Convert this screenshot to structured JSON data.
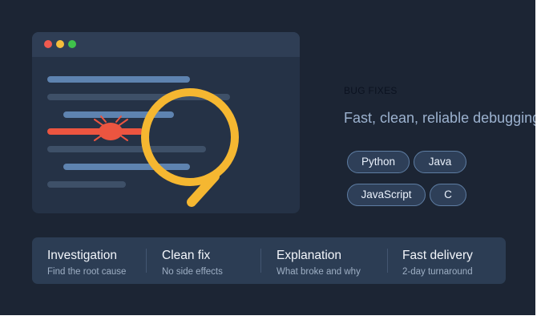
{
  "colors": {
    "background": "#1c2534",
    "editor": "#253246",
    "titlebar": "#2f3e55",
    "bug": "#ec5540",
    "magnifier": "#f5b731",
    "code_line": "#5e83b0",
    "pill_border": "#5e7da3",
    "panel": "#2c3d54"
  },
  "editor": {
    "traffic_lights": [
      "red",
      "yellow",
      "green"
    ],
    "illustration_icons": [
      "bug-icon",
      "magnifier-icon"
    ]
  },
  "section": {
    "heading": "BUG FIXES",
    "tagline": "Fast, clean, reliable debugging"
  },
  "languages": [
    "Python",
    "Java",
    "JavaScript",
    "C"
  ],
  "features": [
    {
      "title": "Investigation",
      "subtitle": "Find the root cause"
    },
    {
      "title": "Clean fix",
      "subtitle": "No side effects"
    },
    {
      "title": "Explanation",
      "subtitle": "What broke and why"
    },
    {
      "title": "Fast delivery",
      "subtitle": "2-day turnaround"
    }
  ]
}
